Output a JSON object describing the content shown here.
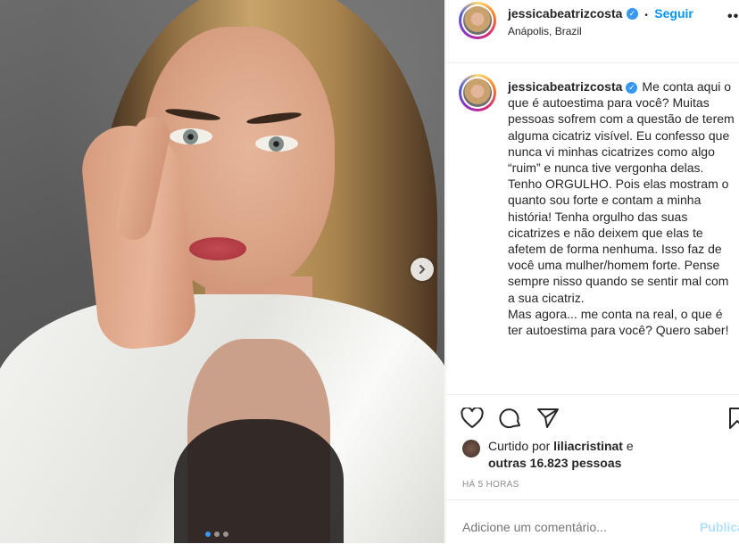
{
  "post": {
    "username": "jessicabeatrizcosta",
    "follow_label": "Seguir",
    "separator": "•",
    "location": "Anápolis, Brazil",
    "verified_glyph": "✓",
    "more_glyph": "•••",
    "caption_text": "Me conta aqui o que é autoestima para você? Muitas pessoas sofrem com a questão de terem alguma cicatriz visível. Eu confesso que nunca vi minhas cicatrizes como algo “ruim” e nunca tive vergonha delas. Tenho ORGULHO. Pois elas mostram o quanto sou forte e contam a minha história! Tenha orgulho das suas cicatrizes e não deixem que elas te afetem de forma nenhuma. Isso faz de você uma mulher/homem forte. Pense sempre nisso quando se sentir mal com a sua cicatriz.\nMas agora... me conta na real, o que é ter autoestima para você? Quero saber!",
    "likes": {
      "prefix": "Curtido por",
      "liker": "liliacristinat",
      "conjunction": "e",
      "others": "outras 16.823 pessoas"
    },
    "timestamp": "HÁ 5 HORAS",
    "comment_placeholder": "Adicione um comentário...",
    "publish_label": "Publicar"
  },
  "carousel": {
    "slide_count": 3,
    "active_index": 0
  },
  "icons": {
    "like": "heart-icon",
    "comment": "comment-icon",
    "share": "paper-plane-icon",
    "save": "bookmark-icon",
    "next": "chevron-right-icon"
  },
  "colors": {
    "accent": "#0095f6",
    "text": "#262626",
    "muted": "#8e8e8e",
    "publish_disabled": "#b2dffc"
  }
}
